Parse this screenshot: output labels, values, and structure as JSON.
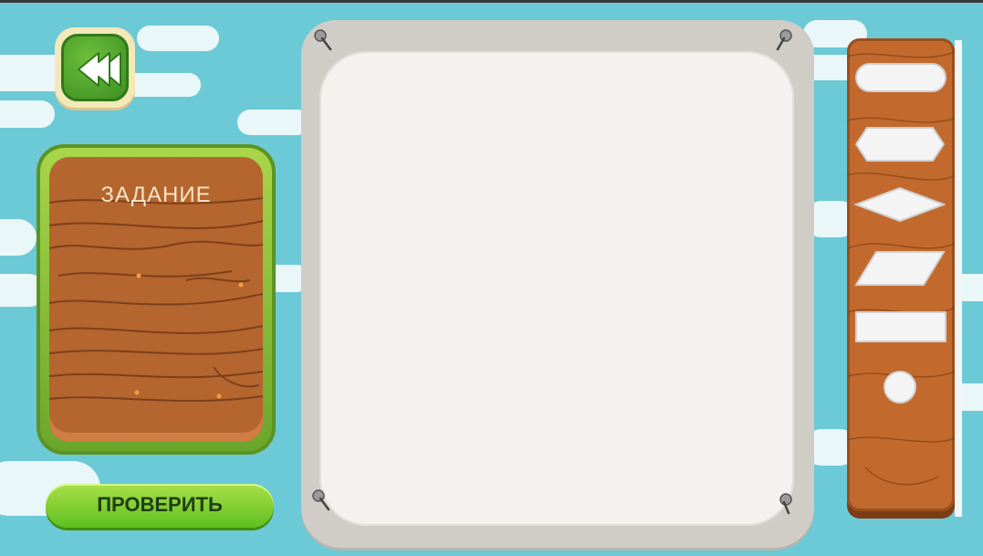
{
  "task_panel": {
    "title": "ЗАДАНИЕ"
  },
  "actions": {
    "check_label": "ПРОВЕРИТЬ"
  },
  "shapes_tray": {
    "items": [
      "rounded-rectangle",
      "hexagon",
      "rhombus",
      "parallelogram",
      "rectangle",
      "circle"
    ]
  },
  "colors": {
    "sky": "#6cc9d6",
    "wood": "#b5652e",
    "green_button": "#6cbf3a",
    "paper": "#f3f2ef"
  }
}
